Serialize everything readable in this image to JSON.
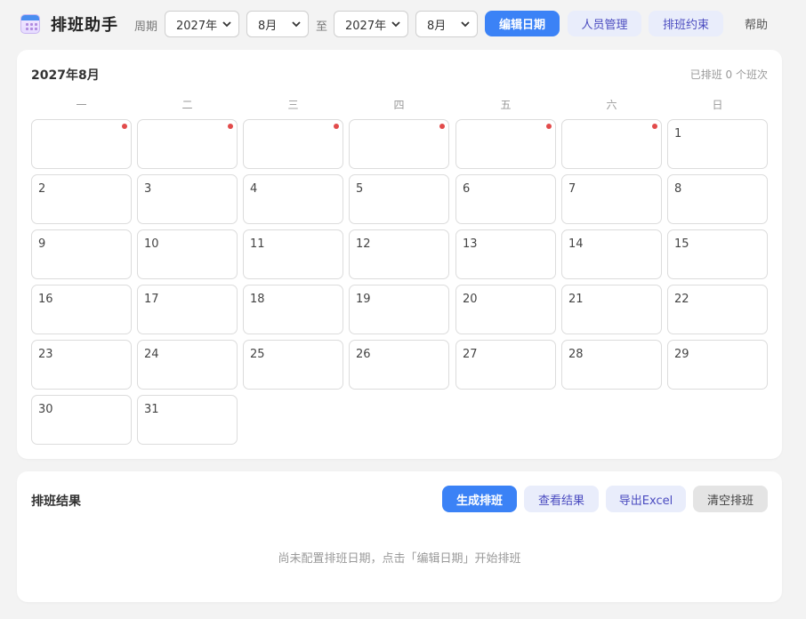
{
  "app": {
    "title": "排班助手",
    "icon": "calendar-icon"
  },
  "period": {
    "label": "周期",
    "start_year": "2027年",
    "start_month": "8月",
    "separator": "至",
    "end_year": "2027年",
    "end_month": "8月"
  },
  "toolbar": {
    "edit_dates": "编辑日期",
    "staff": "人员管理",
    "constraints": "排班约束",
    "help": "帮助"
  },
  "calendar": {
    "title": "2027年8月",
    "scheduled_count": "已排班 0 个班次",
    "weekdays": [
      "一",
      "二",
      "三",
      "四",
      "五",
      "六",
      "日"
    ],
    "days": [
      "1",
      "2",
      "3",
      "4",
      "5",
      "6",
      "7",
      "8",
      "9",
      "10",
      "11",
      "12",
      "13",
      "14",
      "15",
      "16",
      "17",
      "18",
      "19",
      "20",
      "21",
      "22",
      "23",
      "24",
      "25",
      "26",
      "27",
      "28",
      "29",
      "30",
      "31"
    ],
    "leading_blank_count": 6,
    "marker_color": "#e24b4b"
  },
  "results": {
    "title": "排班结果",
    "generate": "生成排班",
    "view": "查看结果",
    "export": "导出Excel",
    "clear": "清空排班",
    "empty_message": "尚未配置排班日期，点击「编辑日期」开始排班"
  },
  "colors": {
    "primary": "#3b82f6",
    "soft_bg": "#e9edfb",
    "soft_text": "#4b4cc0"
  }
}
